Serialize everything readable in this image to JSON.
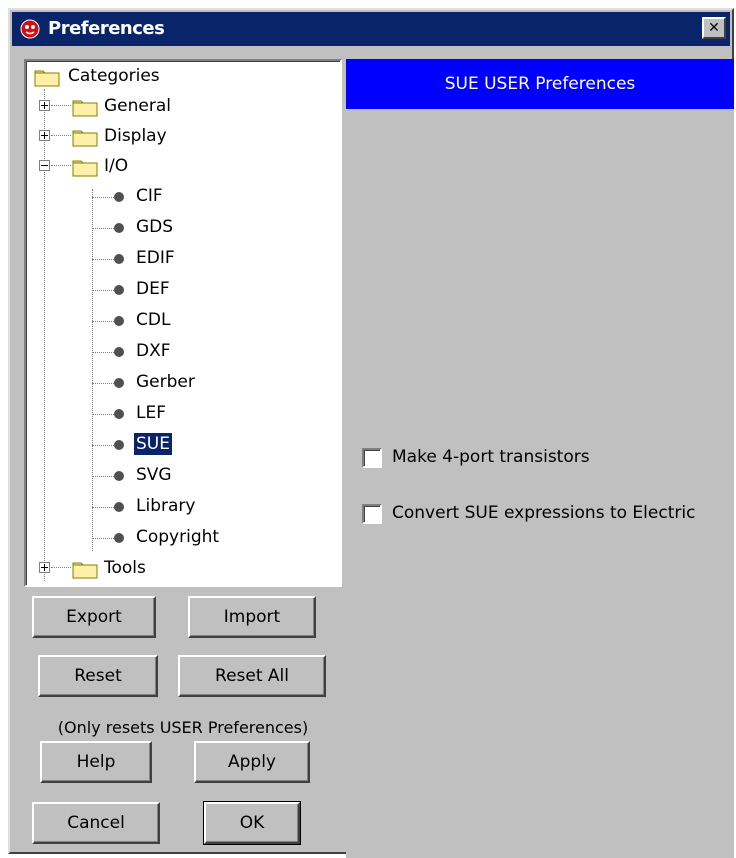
{
  "window": {
    "title": "Preferences",
    "close_glyph": "✕",
    "icon": "electric-app-icon"
  },
  "tree": {
    "root": "Categories",
    "nodes": [
      {
        "label": "General",
        "kind": "folder",
        "expanded": false
      },
      {
        "label": "Display",
        "kind": "folder",
        "expanded": false
      },
      {
        "label": "I/O",
        "kind": "folder",
        "expanded": true
      },
      {
        "label": "CIF",
        "kind": "leaf"
      },
      {
        "label": "GDS",
        "kind": "leaf"
      },
      {
        "label": "EDIF",
        "kind": "leaf"
      },
      {
        "label": "DEF",
        "kind": "leaf"
      },
      {
        "label": "CDL",
        "kind": "leaf"
      },
      {
        "label": "DXF",
        "kind": "leaf"
      },
      {
        "label": "Gerber",
        "kind": "leaf"
      },
      {
        "label": "LEF",
        "kind": "leaf"
      },
      {
        "label": "SUE",
        "kind": "leaf",
        "selected": true
      },
      {
        "label": "SVG",
        "kind": "leaf"
      },
      {
        "label": "Library",
        "kind": "leaf"
      },
      {
        "label": "Copyright",
        "kind": "leaf"
      },
      {
        "label": "Tools",
        "kind": "folder",
        "expanded": false
      }
    ]
  },
  "panel": {
    "header": "SUE USER Preferences",
    "options": [
      {
        "label": "Make 4-port transistors",
        "checked": false
      },
      {
        "label": "Convert SUE expressions to Electric",
        "checked": false
      }
    ]
  },
  "buttons": {
    "export": "Export",
    "import": "Import",
    "reset": "Reset",
    "reset_all": "Reset All",
    "reset_note": "(Only resets USER Preferences)",
    "help": "Help",
    "apply": "Apply",
    "cancel": "Cancel",
    "ok": "OK"
  },
  "colors": {
    "titlebar": "#0a246a",
    "header": "#0000ff",
    "face": "#c0c0c0",
    "folder": "#f5e08a"
  }
}
